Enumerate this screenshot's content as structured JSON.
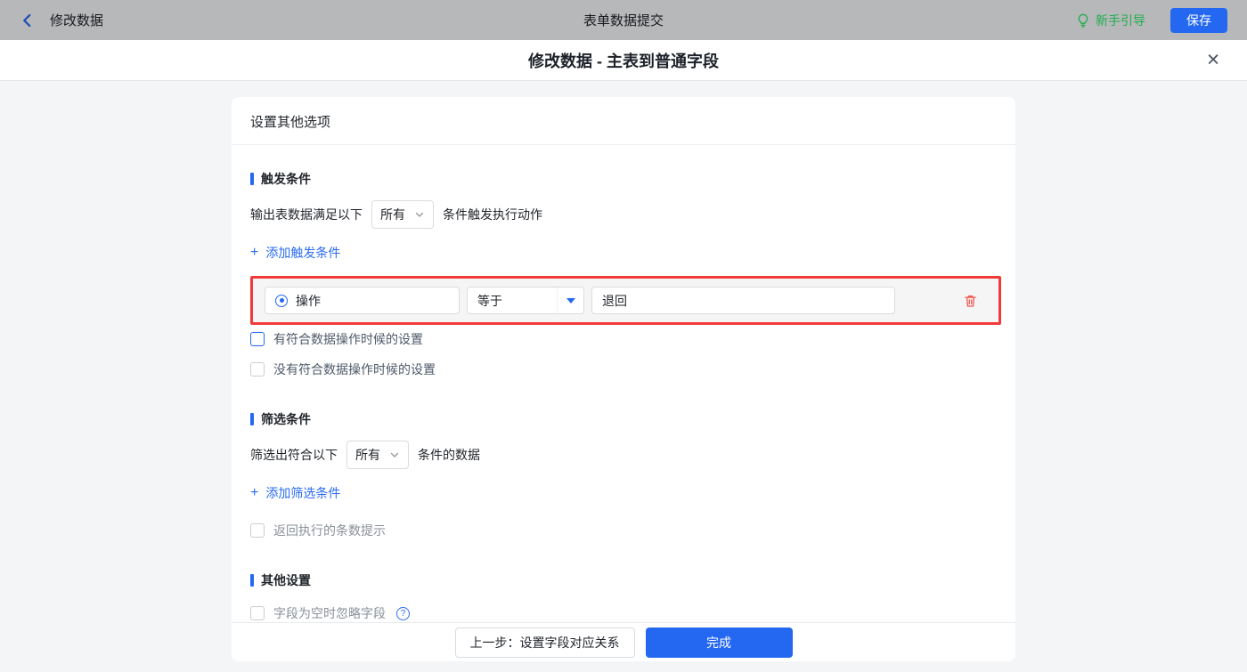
{
  "colors": {
    "accent": "#2468f2",
    "danger": "#f13b3b",
    "green": "#1fae4e"
  },
  "icons": {
    "plus": "+",
    "close": "✕",
    "help": "?"
  },
  "topbar": {
    "back_label": "修改数据",
    "title": "表单数据提交",
    "guide_label": "新手引导",
    "save_label": "保存"
  },
  "modal": {
    "title": "修改数据 - 主表到普通字段"
  },
  "card": {
    "header": "设置其他选项"
  },
  "trigger": {
    "title": "触发条件",
    "sentence_pre": "输出表数据满足以下",
    "select_value": "所有",
    "sentence_post": "条件触发执行动作",
    "add_label": "添加触发条件",
    "condition_row": {
      "field": "操作",
      "operator": "等于",
      "value": "退回"
    },
    "checkboxes": [
      {
        "label": "有符合数据操作时候的设置"
      },
      {
        "label": "没有符合数据操作时候的设置"
      }
    ]
  },
  "filter": {
    "title": "筛选条件",
    "sentence_pre": "筛选出符合以下",
    "select_value": "所有",
    "sentence_post": "条件的数据",
    "add_label": "添加筛选条件",
    "checkbox_label": "返回执行的条数提示"
  },
  "other": {
    "title": "其他设置",
    "checkbox_label": "字段为空时忽略字段"
  },
  "footer": {
    "prev_label": "上一步：设置字段对应关系",
    "done_label": "完成"
  }
}
